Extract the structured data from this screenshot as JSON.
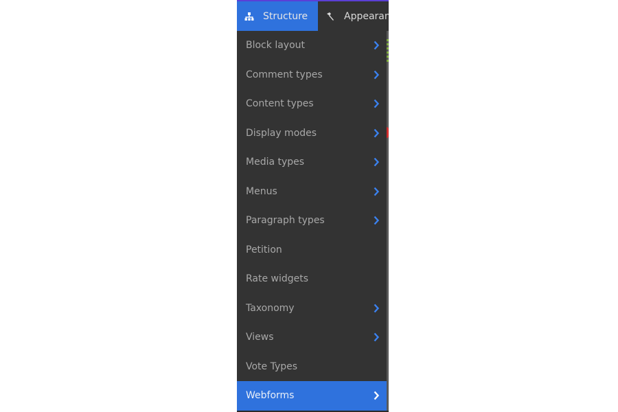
{
  "toolbar": {
    "tabs": [
      {
        "label": "Structure",
        "icon": "sitemap-icon",
        "active": true
      },
      {
        "label": "Appearance",
        "icon": "paintbrush-icon",
        "active": false
      }
    ]
  },
  "menu": {
    "items": [
      {
        "label": "Block layout",
        "has_submenu": true
      },
      {
        "label": "Comment types",
        "has_submenu": true
      },
      {
        "label": "Content types",
        "has_submenu": true
      },
      {
        "label": "Display modes",
        "has_submenu": true
      },
      {
        "label": "Media types",
        "has_submenu": true
      },
      {
        "label": "Menus",
        "has_submenu": true
      },
      {
        "label": "Paragraph types",
        "has_submenu": true
      },
      {
        "label": "Petition",
        "has_submenu": false
      },
      {
        "label": "Rate widgets",
        "has_submenu": false
      },
      {
        "label": "Taxonomy",
        "has_submenu": true
      },
      {
        "label": "Views",
        "has_submenu": true
      },
      {
        "label": "Vote Types",
        "has_submenu": false
      },
      {
        "label": "Webforms",
        "has_submenu": true,
        "active": true
      }
    ]
  },
  "colors": {
    "toolbar_bg": "#333333",
    "active_blue": "#2f72dd",
    "chevron_blue": "#3b82f0",
    "menu_text": "#a8a8a8",
    "top_accent": "#5b3fd6"
  }
}
